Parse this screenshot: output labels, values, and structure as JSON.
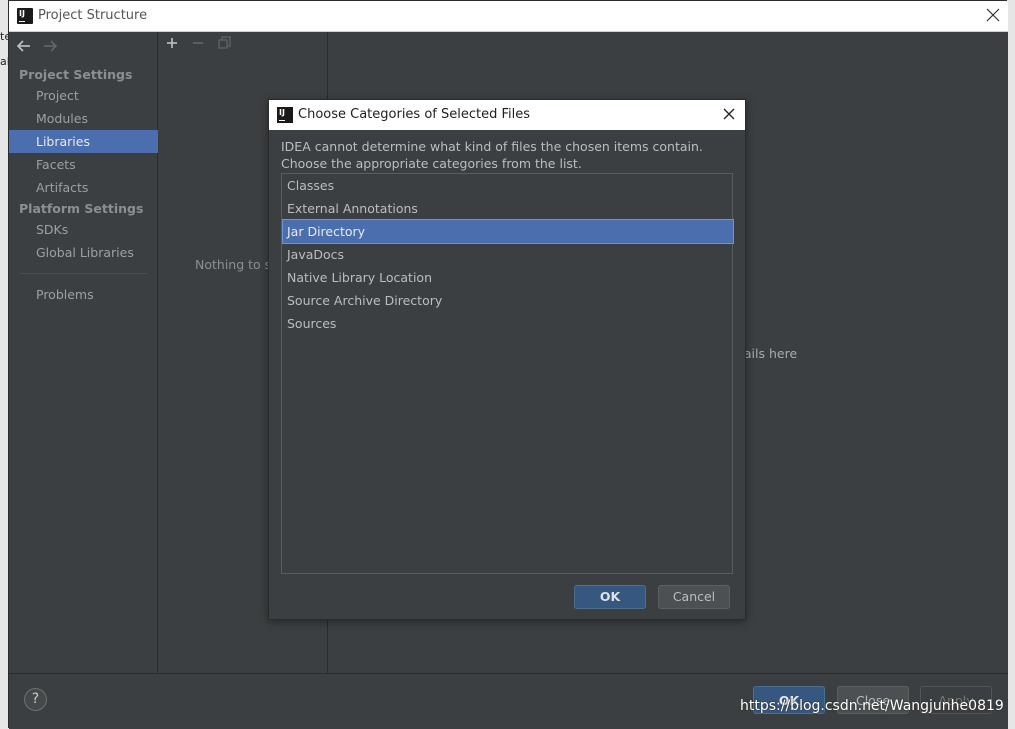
{
  "window": {
    "title": "Project Structure",
    "close_icon": "close-icon"
  },
  "nav": {
    "back_icon": "arrow-left-icon",
    "forward_icon": "arrow-right-icon",
    "project_settings": "Project Settings",
    "project_items": [
      "Project",
      "Modules",
      "Libraries",
      "Facets",
      "Artifacts"
    ],
    "platform_settings": "Platform Settings",
    "platform_items": [
      "SDKs",
      "Global Libraries"
    ],
    "problems": "Problems",
    "selected": "Libraries"
  },
  "midpanel": {
    "nothing_text": "Nothing to sh"
  },
  "detail": {
    "text": "tails here"
  },
  "dialog": {
    "title": "Choose Categories of Selected Files",
    "message_line1": "IDEA cannot determine what kind of files the chosen items contain.",
    "message_line2": "Choose the appropriate categories from the list.",
    "categories": [
      "Classes",
      "External Annotations",
      "Jar Directory",
      "JavaDocs",
      "Native Library Location",
      "Source Archive Directory",
      "Sources"
    ],
    "selected": "Jar Directory",
    "ok_label": "OK",
    "cancel_label": "Cancel"
  },
  "bottom": {
    "help_label": "?",
    "ok_label": "OK",
    "close_label": "Close",
    "apply_label": "Apply"
  },
  "watermark": "https://blog.csdn.net/Wangjunhe0819",
  "left_fragments": [
    "te",
    "al"
  ],
  "colors": {
    "accent": "#4b6eaf",
    "background": "#3c3f41",
    "primary_button": "#365880"
  }
}
